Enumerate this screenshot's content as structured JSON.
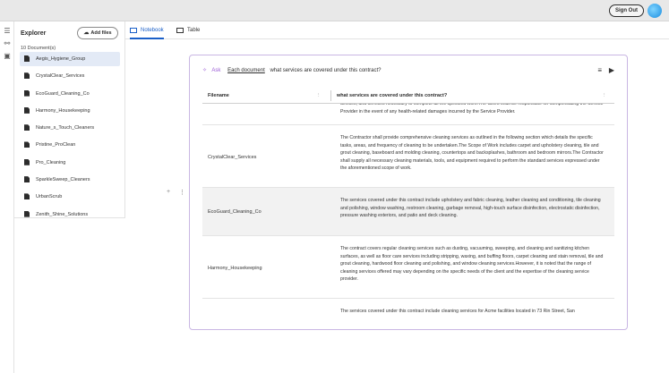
{
  "header": {
    "sign_out_label": "Sign Out"
  },
  "rail": {
    "icons": [
      "list-icon",
      "tree-icon",
      "panel-icon"
    ]
  },
  "explorer": {
    "title": "Explorer",
    "add_files_label": "Add files",
    "doc_count": "10 Document(s)",
    "files": [
      "Aegis_Hygiene_Group",
      "CrystalClear_Services",
      "EcoGuard_Cleaning_Co",
      "Harmony_Housekeeping",
      "Nature_s_Touch_Cleaners",
      "Pristine_ProClean",
      "Pro_Cleaning",
      "SparkleSweep_Cleaners",
      "UrbanScrub",
      "Zenith_Shine_Solutions"
    ],
    "selected": "Aegis_Hygiene_Group"
  },
  "tabs": [
    {
      "label": "Notebook",
      "active": true
    },
    {
      "label": "Table",
      "active": false
    }
  ],
  "gutter": {
    "add": "+",
    "drag": "⋮"
  },
  "query": {
    "ask_label": "Ask",
    "scope_label": "Each document",
    "question": "what services are covered under this contract?",
    "menu_icon": "≡",
    "run_icon": "▶"
  },
  "table": {
    "columns": [
      "Filename",
      "what services are covered under this contract?"
    ],
    "rows": [
      {
        "filename": "",
        "answer": "devices, and services necessary to complete all the specified work.The Client shall be responsible for compensating the Service Provider in the event of any health-related damages incurred by the Service Provider."
      },
      {
        "filename": "CrystalClear_Services",
        "answer": "The Contractor shall provide comprehensive cleaning services as outlined in the following section which details the specific tasks, areas, and frequency of cleaning to be undertaken.The Scope of Work includes carpet and upholstery cleaning, tile and grout cleaning, baseboard and molding cleaning, countertops and backsplashes, bathroom and bedroom mirrors.The Contractor shall supply all necessary cleaning materials, tools, and equipment required to perform the standard services expressed under the aforementioned scope of work."
      },
      {
        "filename": "EcoGuard_Cleaning_Co",
        "answer": "The services covered under this contract include upholstery and fabric cleaning, leather cleaning and conditioning, tile cleaning and polishing, window washing, restroom cleaning, garbage removal, high-touch surface disinfection, electrostatic disinfection, pressure washing exteriors, and patio and deck cleaning."
      },
      {
        "filename": "Harmony_Housekeeping",
        "answer": "The contract covers regular cleaning services such as dusting, vacuuming, sweeping, and cleaning and sanitizing kitchen surfaces, as well as floor care services including stripping, waxing, and buffing floors, carpet cleaning and stain removal, tile and grout cleaning, hardwood floor cleaning and polishing, and window cleaning services.However, it is noted that the range of cleaning services offered may vary depending on the specific needs of the client and the expertise of the cleaning service provider."
      },
      {
        "filename": "",
        "answer": "The services covered under this contract include cleaning services for Acme facilities located in 73 Rin Street, San"
      }
    ]
  }
}
